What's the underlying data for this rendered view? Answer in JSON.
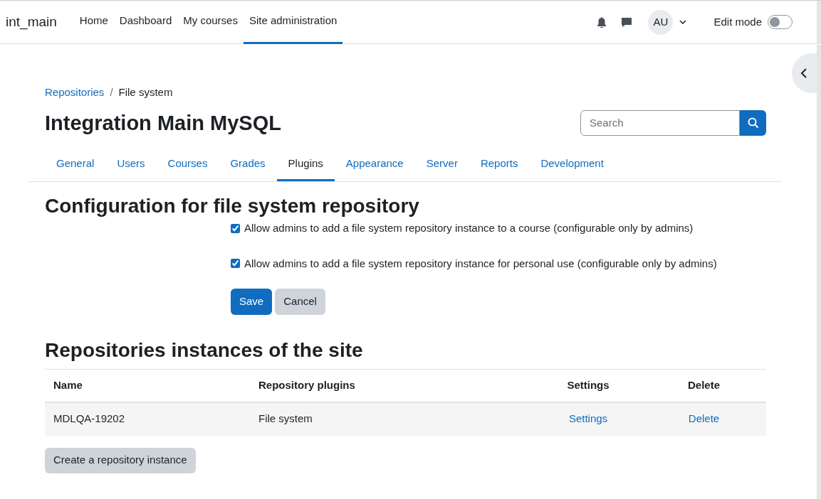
{
  "navbar": {
    "site_name": "int_main",
    "items": [
      {
        "label": "Home",
        "selected": false
      },
      {
        "label": "Dashboard",
        "selected": false
      },
      {
        "label": "My courses",
        "selected": false
      },
      {
        "label": "Site administration",
        "selected": true
      }
    ],
    "avatar": "AU",
    "edit_mode": {
      "label": "Edit mode",
      "on": false
    }
  },
  "breadcrumb": {
    "separator": "/",
    "items": [
      {
        "label": "Repositories",
        "kind": "link"
      },
      {
        "label": "File system",
        "kind": "current"
      }
    ]
  },
  "page_title": "Integration Main MySQL",
  "search": {
    "placeholder": "Search"
  },
  "tabs": [
    {
      "label": "General",
      "selected": false
    },
    {
      "label": "Users",
      "selected": false
    },
    {
      "label": "Courses",
      "selected": false
    },
    {
      "label": "Grades",
      "selected": false
    },
    {
      "label": "Plugins",
      "selected": true
    },
    {
      "label": "Appearance",
      "selected": false
    },
    {
      "label": "Server",
      "selected": false
    },
    {
      "label": "Reports",
      "selected": false
    },
    {
      "label": "Development",
      "selected": false
    }
  ],
  "config": {
    "heading": "Configuration for file system repository",
    "options": [
      {
        "label": "Allow admins to add a file system repository instance to a course (configurable only by admins)",
        "checked": true
      },
      {
        "label": "Allow admins to add a file system repository instance for personal use (configurable only by admins)",
        "checked": true
      }
    ],
    "buttons": [
      {
        "label": "Save",
        "kind": "primary"
      },
      {
        "label": "Cancel",
        "kind": "secondary"
      }
    ]
  },
  "instances": {
    "heading": "Repositories instances of the site",
    "columns": [
      "Name",
      "Repository plugins",
      "Settings",
      "Delete"
    ],
    "rows": [
      [
        "MDLQA-19202",
        "File system",
        "Settings",
        "Delete"
      ]
    ],
    "create_button": "Create a repository instance"
  }
}
